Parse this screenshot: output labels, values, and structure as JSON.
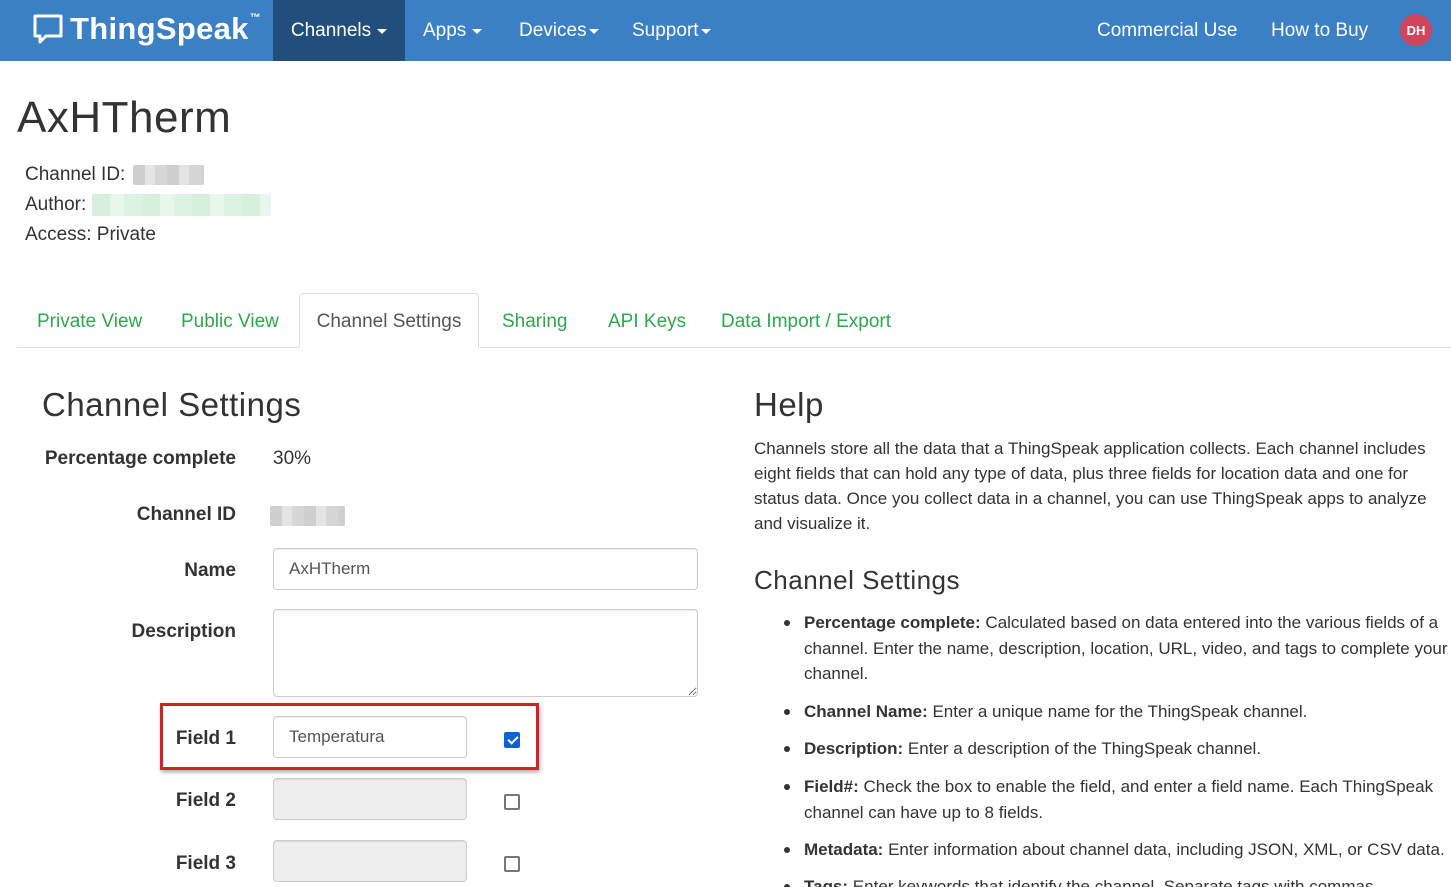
{
  "navbar": {
    "brand": "ThingSpeak",
    "brand_tm": "™",
    "items": [
      {
        "label": "Channels"
      },
      {
        "label": "Apps"
      },
      {
        "label": "Devices"
      },
      {
        "label": "Support"
      }
    ],
    "right_links": [
      {
        "label": "Commercial Use"
      },
      {
        "label": "How to Buy"
      }
    ],
    "avatar_initials": "DH",
    "colors": {
      "bar": "#3b7fc4",
      "active": "#214e7a",
      "avatar": "#d0445c"
    }
  },
  "channel": {
    "title": "AxHTherm",
    "id_label": "Channel ID:",
    "author_label": "Author:",
    "access": "Access: Private"
  },
  "tabs": [
    {
      "label": "Private View"
    },
    {
      "label": "Public View"
    },
    {
      "label": "Channel Settings",
      "active": true
    },
    {
      "label": "Sharing"
    },
    {
      "label": "API Keys"
    },
    {
      "label": "Data Import / Export"
    }
  ],
  "settings": {
    "title": "Channel Settings",
    "percentage_label": "Percentage complete",
    "percentage_value": "30%",
    "channel_id_label": "Channel ID",
    "name_label": "Name",
    "name_value": "AxHTherm",
    "description_label": "Description",
    "description_value": "",
    "fields": [
      {
        "label": "Field 1",
        "value": "Temperatura",
        "enabled": true
      },
      {
        "label": "Field 2",
        "value": "",
        "enabled": false
      },
      {
        "label": "Field 3",
        "value": "",
        "enabled": false
      }
    ]
  },
  "help": {
    "title": "Help",
    "intro": "Channels store all the data that a ThingSpeak application collects. Each channel includes eight fields that can hold any type of data, plus three fields for location data and one for status data. Once you collect data in a channel, you can use ThingSpeak apps to analyze and visualize it.",
    "subtitle": "Channel Settings",
    "items": [
      {
        "term": "Percentage complete:",
        "text": " Calculated based on data entered into the various fields of a channel. Enter the name, description, location, URL, video, and tags to complete your channel."
      },
      {
        "term": "Channel Name:",
        "text": " Enter a unique name for the ThingSpeak channel."
      },
      {
        "term": "Description:",
        "text": " Enter a description of the ThingSpeak channel."
      },
      {
        "term": "Field#:",
        "text": " Check the box to enable the field, and enter a field name. Each ThingSpeak channel can have up to 8 fields."
      },
      {
        "term": "Metadata:",
        "text": " Enter information about channel data, including JSON, XML, or CSV data."
      },
      {
        "term": "Tags:",
        "text": " Enter keywords that identify the channel. Separate tags with commas."
      }
    ]
  },
  "colors": {
    "tab_link": "#2ca94b",
    "highlight_box": "#d62027",
    "checkbox_checked": "#0b62d6"
  }
}
